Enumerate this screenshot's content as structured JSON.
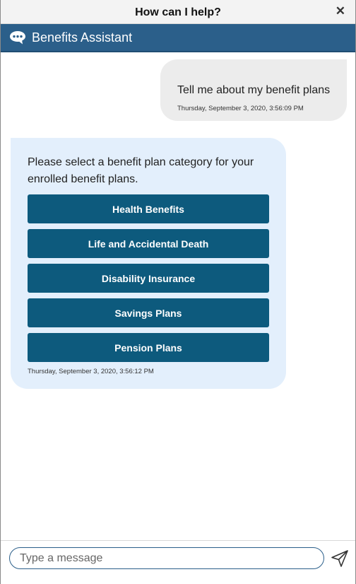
{
  "window": {
    "title": "How can I help?",
    "close_glyph": "✕"
  },
  "header": {
    "assistant_name": "Benefits Assistant",
    "icon": "chat-bubble-icon",
    "color": "#2b5f8a"
  },
  "messages": [
    {
      "sender": "user",
      "text": "Tell me about my benefit plans",
      "timestamp": "Thursday, September 3, 2020, 3:56:09 PM"
    },
    {
      "sender": "bot",
      "text": "Please select a benefit plan category for your enrolled benefit plans.",
      "options": [
        "Health Benefits",
        "Life and Accidental Death",
        "Disability Insurance",
        "Savings Plans",
        "Pension Plans"
      ],
      "timestamp": "Thursday, September 3, 2020, 3:56:12 PM"
    }
  ],
  "composer": {
    "placeholder": "Type a message",
    "value": "",
    "send_icon": "send-icon"
  },
  "colors": {
    "user_bubble": "#ececec",
    "bot_bubble": "#e3effc",
    "option_button": "#0d5a7d"
  }
}
